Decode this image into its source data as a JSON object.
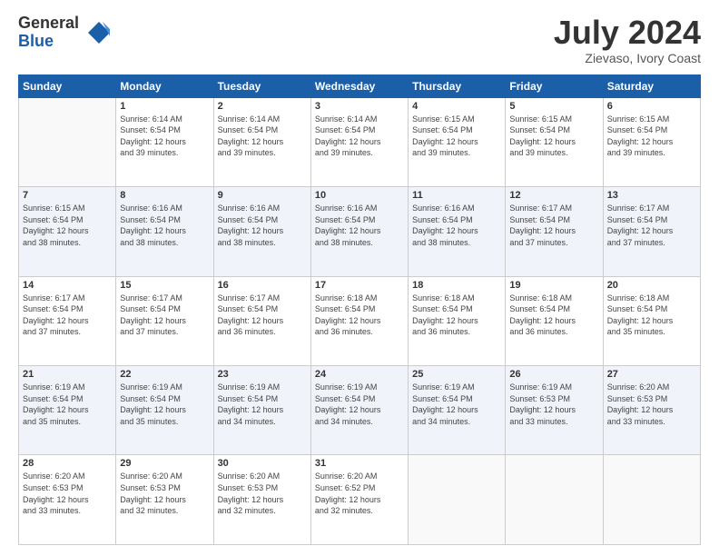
{
  "logo": {
    "general": "General",
    "blue": "Blue"
  },
  "title": "July 2024",
  "location": "Zievaso, Ivory Coast",
  "days_header": [
    "Sunday",
    "Monday",
    "Tuesday",
    "Wednesday",
    "Thursday",
    "Friday",
    "Saturday"
  ],
  "weeks": [
    [
      {
        "day": "",
        "info": ""
      },
      {
        "day": "1",
        "info": "Sunrise: 6:14 AM\nSunset: 6:54 PM\nDaylight: 12 hours\nand 39 minutes."
      },
      {
        "day": "2",
        "info": "Sunrise: 6:14 AM\nSunset: 6:54 PM\nDaylight: 12 hours\nand 39 minutes."
      },
      {
        "day": "3",
        "info": "Sunrise: 6:14 AM\nSunset: 6:54 PM\nDaylight: 12 hours\nand 39 minutes."
      },
      {
        "day": "4",
        "info": "Sunrise: 6:15 AM\nSunset: 6:54 PM\nDaylight: 12 hours\nand 39 minutes."
      },
      {
        "day": "5",
        "info": "Sunrise: 6:15 AM\nSunset: 6:54 PM\nDaylight: 12 hours\nand 39 minutes."
      },
      {
        "day": "6",
        "info": "Sunrise: 6:15 AM\nSunset: 6:54 PM\nDaylight: 12 hours\nand 39 minutes."
      }
    ],
    [
      {
        "day": "7",
        "info": "Sunrise: 6:15 AM\nSunset: 6:54 PM\nDaylight: 12 hours\nand 38 minutes."
      },
      {
        "day": "8",
        "info": "Sunrise: 6:16 AM\nSunset: 6:54 PM\nDaylight: 12 hours\nand 38 minutes."
      },
      {
        "day": "9",
        "info": "Sunrise: 6:16 AM\nSunset: 6:54 PM\nDaylight: 12 hours\nand 38 minutes."
      },
      {
        "day": "10",
        "info": "Sunrise: 6:16 AM\nSunset: 6:54 PM\nDaylight: 12 hours\nand 38 minutes."
      },
      {
        "day": "11",
        "info": "Sunrise: 6:16 AM\nSunset: 6:54 PM\nDaylight: 12 hours\nand 38 minutes."
      },
      {
        "day": "12",
        "info": "Sunrise: 6:17 AM\nSunset: 6:54 PM\nDaylight: 12 hours\nand 37 minutes."
      },
      {
        "day": "13",
        "info": "Sunrise: 6:17 AM\nSunset: 6:54 PM\nDaylight: 12 hours\nand 37 minutes."
      }
    ],
    [
      {
        "day": "14",
        "info": "Sunrise: 6:17 AM\nSunset: 6:54 PM\nDaylight: 12 hours\nand 37 minutes."
      },
      {
        "day": "15",
        "info": "Sunrise: 6:17 AM\nSunset: 6:54 PM\nDaylight: 12 hours\nand 37 minutes."
      },
      {
        "day": "16",
        "info": "Sunrise: 6:17 AM\nSunset: 6:54 PM\nDaylight: 12 hours\nand 36 minutes."
      },
      {
        "day": "17",
        "info": "Sunrise: 6:18 AM\nSunset: 6:54 PM\nDaylight: 12 hours\nand 36 minutes."
      },
      {
        "day": "18",
        "info": "Sunrise: 6:18 AM\nSunset: 6:54 PM\nDaylight: 12 hours\nand 36 minutes."
      },
      {
        "day": "19",
        "info": "Sunrise: 6:18 AM\nSunset: 6:54 PM\nDaylight: 12 hours\nand 36 minutes."
      },
      {
        "day": "20",
        "info": "Sunrise: 6:18 AM\nSunset: 6:54 PM\nDaylight: 12 hours\nand 35 minutes."
      }
    ],
    [
      {
        "day": "21",
        "info": "Sunrise: 6:19 AM\nSunset: 6:54 PM\nDaylight: 12 hours\nand 35 minutes."
      },
      {
        "day": "22",
        "info": "Sunrise: 6:19 AM\nSunset: 6:54 PM\nDaylight: 12 hours\nand 35 minutes."
      },
      {
        "day": "23",
        "info": "Sunrise: 6:19 AM\nSunset: 6:54 PM\nDaylight: 12 hours\nand 34 minutes."
      },
      {
        "day": "24",
        "info": "Sunrise: 6:19 AM\nSunset: 6:54 PM\nDaylight: 12 hours\nand 34 minutes."
      },
      {
        "day": "25",
        "info": "Sunrise: 6:19 AM\nSunset: 6:54 PM\nDaylight: 12 hours\nand 34 minutes."
      },
      {
        "day": "26",
        "info": "Sunrise: 6:19 AM\nSunset: 6:53 PM\nDaylight: 12 hours\nand 33 minutes."
      },
      {
        "day": "27",
        "info": "Sunrise: 6:20 AM\nSunset: 6:53 PM\nDaylight: 12 hours\nand 33 minutes."
      }
    ],
    [
      {
        "day": "28",
        "info": "Sunrise: 6:20 AM\nSunset: 6:53 PM\nDaylight: 12 hours\nand 33 minutes."
      },
      {
        "day": "29",
        "info": "Sunrise: 6:20 AM\nSunset: 6:53 PM\nDaylight: 12 hours\nand 32 minutes."
      },
      {
        "day": "30",
        "info": "Sunrise: 6:20 AM\nSunset: 6:53 PM\nDaylight: 12 hours\nand 32 minutes."
      },
      {
        "day": "31",
        "info": "Sunrise: 6:20 AM\nSunset: 6:52 PM\nDaylight: 12 hours\nand 32 minutes."
      },
      {
        "day": "",
        "info": ""
      },
      {
        "day": "",
        "info": ""
      },
      {
        "day": "",
        "info": ""
      }
    ]
  ]
}
